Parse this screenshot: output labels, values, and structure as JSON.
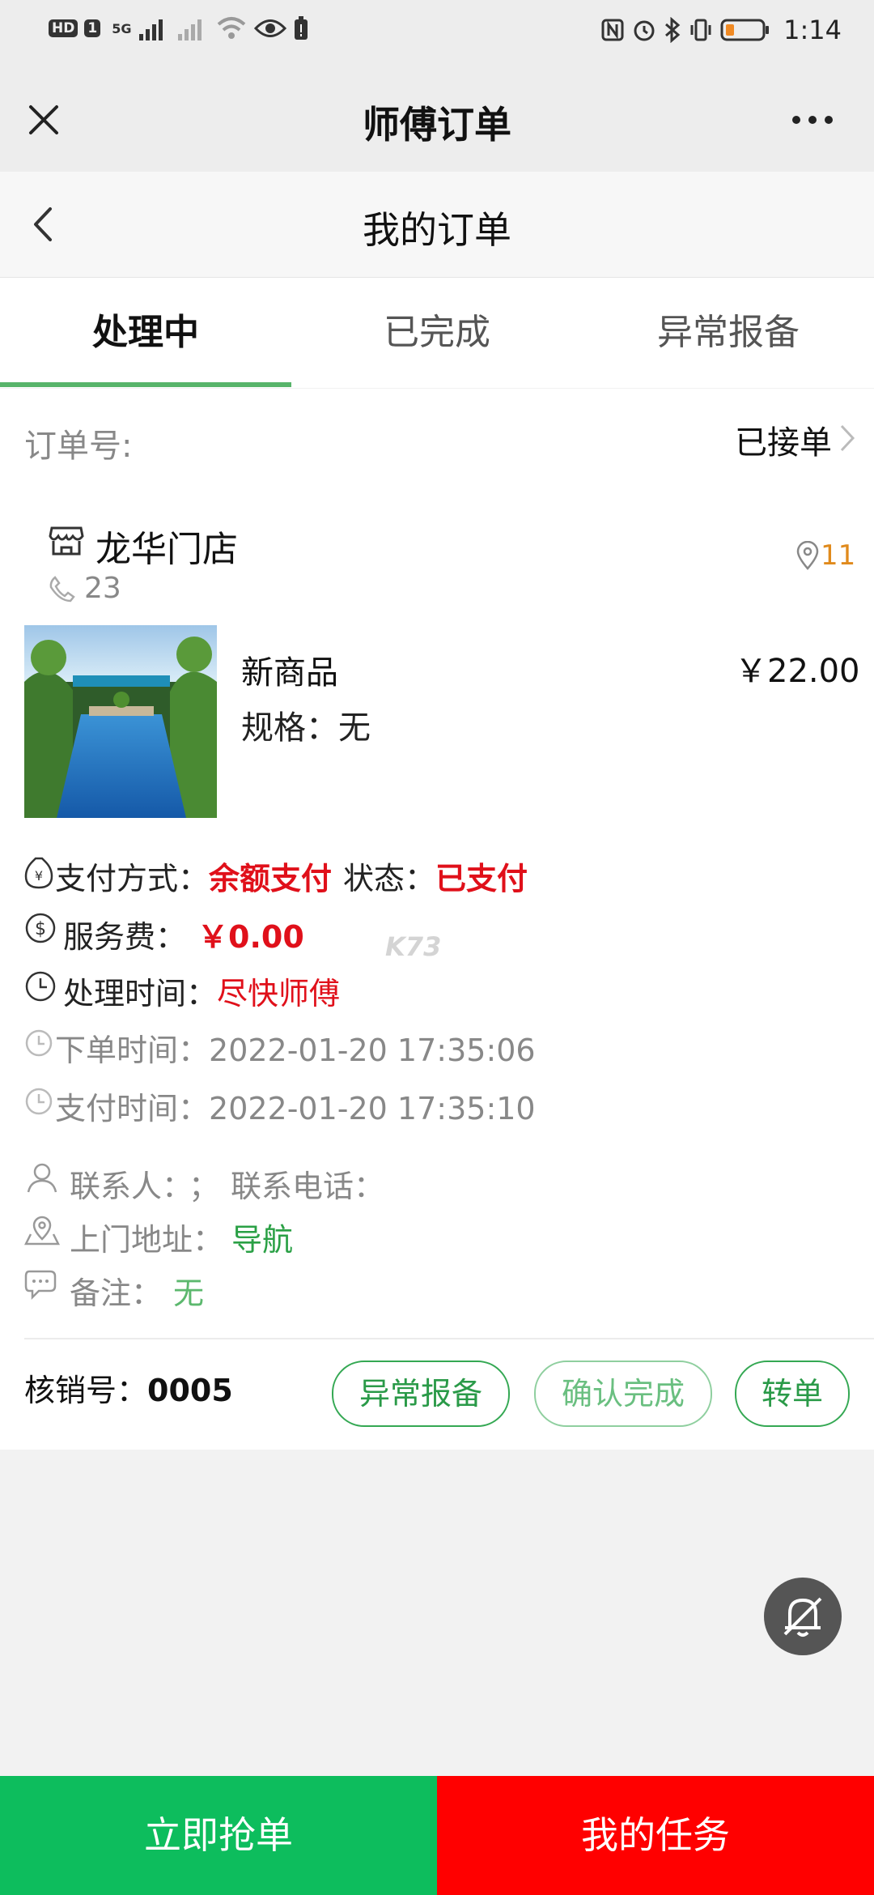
{
  "status_bar": {
    "hd_label": "HD",
    "sim_label": "1",
    "network_label": "5G",
    "time": "1:14",
    "battery_color": "#f08a24"
  },
  "titlebar": {
    "title": "师傅订单",
    "close_icon": "close-icon",
    "more_icon": "more-icon"
  },
  "page_header": {
    "title": "我的订单",
    "back_icon": "chevron-left-icon"
  },
  "tabs": [
    {
      "label": "处理中",
      "active": true
    },
    {
      "label": "已完成",
      "active": false
    },
    {
      "label": "异常报备",
      "active": false
    }
  ],
  "order": {
    "order_no_label": "订单号:",
    "status": "已接单",
    "store_name": "龙华门店",
    "store_phone": "23",
    "distance": "11",
    "product_name": "新商品",
    "spec": "规格：无",
    "price": "￥22.00",
    "pay_method_label": "支付方式：",
    "pay_method": "余额支付",
    "pay_status_label": "状态：",
    "pay_status": "已支付",
    "service_fee_label": "服务费：",
    "service_fee": "￥0.00",
    "process_time_label": "处理时间：",
    "process_time": "尽快师傅",
    "order_time_label": "下单时间：",
    "order_time": "2022-01-20 17:35:06",
    "pay_time_label": "支付时间：",
    "pay_time": "2022-01-20 17:35:10",
    "contact_label": "联系人：",
    "contact_sep": "；",
    "phone_label": "联系电话：",
    "address_label": "上门地址：",
    "navigate": "导航",
    "remark_label": "备注：",
    "remark": "无",
    "verify_label": "核销号：",
    "verify_code": "0005",
    "buttons": {
      "report": "异常报备",
      "confirm": "确认完成",
      "transfer": "转单"
    }
  },
  "watermark": "K73",
  "bottom": {
    "grab": "立即抢单",
    "tasks": "我的任务"
  },
  "colors": {
    "accent_green": "#0dbd5d",
    "danger_red": "#ff0000",
    "price_red": "#e0101a"
  }
}
